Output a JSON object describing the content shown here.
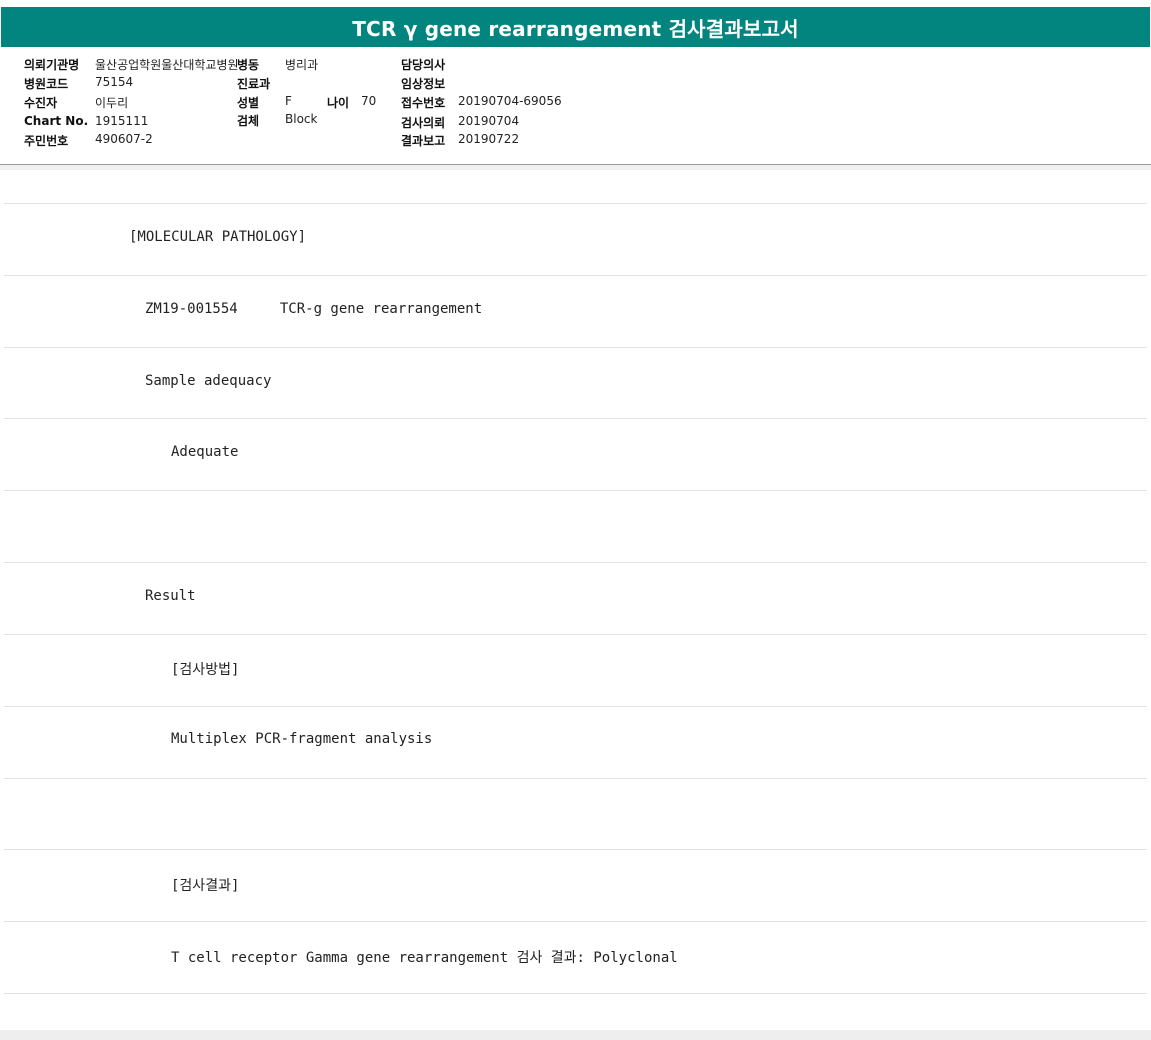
{
  "report": {
    "title": "TCR γ gene rearrangement 검사결과보고서"
  },
  "header": {
    "requesting_institution_label": "의뢰기관명",
    "requesting_institution_value": "울산공업학원울산대학교병원",
    "ward_label": "병동",
    "ward_value": "병리과",
    "attending_label": "담당의사",
    "attending_value": "",
    "hospital_code_label": "병원코드",
    "hospital_code_value": "75154",
    "department_label": "진료과",
    "department_value": "",
    "clinical_info_label": "임상정보",
    "clinical_info_value": "",
    "patient_label": "수진자",
    "patient_value": "이두리",
    "sex_label": "성별",
    "sex_value": "F",
    "age_label": "나이",
    "age_value": "70",
    "accession_label": "접수번호",
    "accession_value": "20190704-69056",
    "chart_label": "Chart No.",
    "chart_value": "1915111",
    "specimen_label": "검체",
    "specimen_value": "Block",
    "request_date_label": "검사의뢰",
    "request_date_value": "20190704",
    "id_label": "주민번호",
    "id_value": "490607-2",
    "report_date_label": "결과보고",
    "report_date_value": "20190722"
  },
  "body": {
    "rows": [
      "",
      "[MOLECULAR PATHOLOGY]",
      "ZM19-001554     TCR-g gene rearrangement",
      "Sample adequacy",
      "Adequate",
      "",
      "Result",
      "[검사방법]",
      "Multiplex PCR-fragment analysis",
      "",
      "[검사결과]",
      "T cell receptor Gamma gene rearrangement 검사 결과: Polyclonal"
    ]
  }
}
